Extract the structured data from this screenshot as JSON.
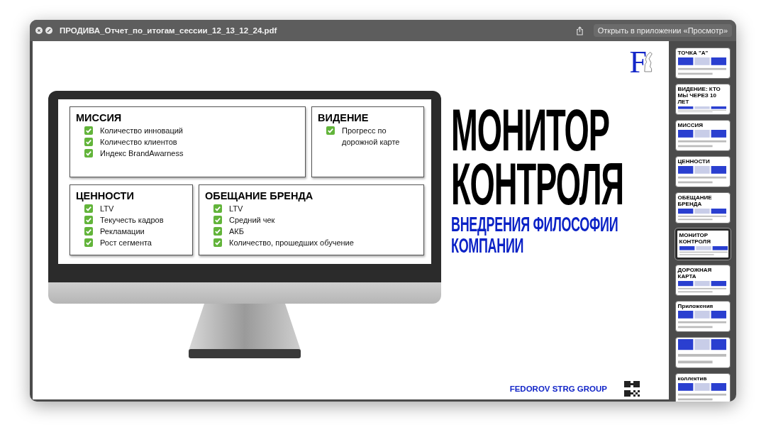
{
  "window": {
    "title": "ПРОДИВА_Отчет_по_итогам_сессии_12_13_12_24.pdf",
    "open_button": "Открыть в приложении «Просмотр»"
  },
  "slide": {
    "logo_letter": "F",
    "boxes": [
      {
        "title": "МИССИЯ",
        "items": [
          "Количество инноваций",
          "Количество клиентов",
          "Индекс BrandAwarness"
        ]
      },
      {
        "title": "ВИДЕНИЕ",
        "items": [
          "Прогресс по дорожной карте"
        ]
      },
      {
        "title": "ЦЕННОСТИ",
        "items": [
          "LTV",
          "Текучесть кадров",
          "Рекламации",
          "Рост сегмента"
        ]
      },
      {
        "title": "ОБЕЩАНИЕ БРЕНДА",
        "items": [
          "LTV",
          "Средний чек",
          "АКБ",
          "Количество, прошедших обучение"
        ]
      }
    ],
    "title_lines": [
      "МОНИТОР",
      "КОНТРОЛЯ"
    ],
    "subtitle": "ВНЕДРЕНИЯ ФИЛОСОФИИ КОМПАНИИ",
    "footer": "FEDOROV STRG GROUP"
  },
  "thumbnails": [
    {
      "title": "ТОЧКА \"А\"",
      "selected": false
    },
    {
      "title": "ВИДЕНИЕ: КТО МЫ ЧЕРЕЗ 10 ЛЕТ",
      "selected": false
    },
    {
      "title": "МИССИЯ",
      "selected": false
    },
    {
      "title": "ЦЕННОСТИ",
      "selected": false
    },
    {
      "title": "ОБЕЩАНИЕ БРЕНДА",
      "selected": false
    },
    {
      "title": "МОНИТОР КОНТРОЛЯ",
      "selected": true
    },
    {
      "title": "ДОРОЖНАЯ КАРТА",
      "selected": false
    },
    {
      "title": "Приложения",
      "selected": false
    },
    {
      "selected": false
    },
    {
      "title": "коллектив",
      "selected": false
    }
  ]
}
